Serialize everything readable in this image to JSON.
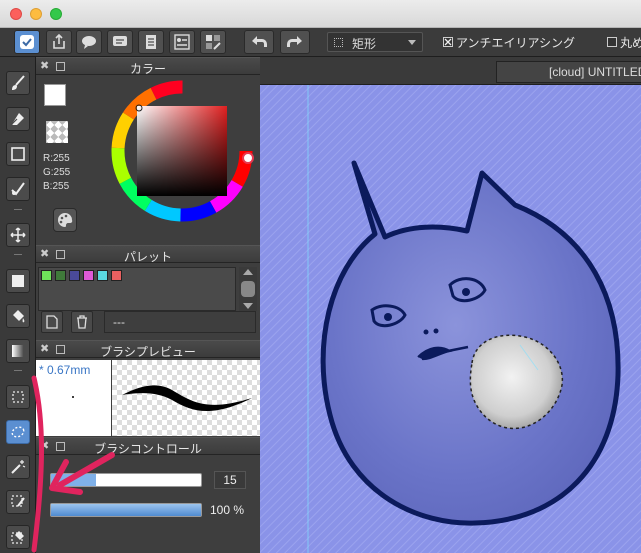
{
  "colors": {
    "canvas_bg": "#8a93e8",
    "cat_fill": "#6a74c8",
    "outline": "#0b1a5c",
    "annotation": "#e0245e",
    "accent": "#5b8fd1"
  },
  "toolbar": {
    "shape_select": "矩形",
    "antialias_label": "アンチエイリアシング",
    "antialias_checked": true,
    "round_label": "丸め",
    "round_checked": false,
    "icons": [
      "eye-icon",
      "share-icon",
      "comment-icon",
      "chat-icon",
      "document-icon",
      "panel-icon",
      "palette-icon",
      "undo-icon",
      "redo-icon"
    ]
  },
  "tools": [
    "brush-icon",
    "eraser-icon",
    "rectangle-icon",
    "smudge-icon",
    "move-icon",
    "fill-square-icon",
    "bucket-icon",
    "gradient-icon",
    "rect-select-icon",
    "lasso-select-icon",
    "magic-wand-icon",
    "select-pen-icon",
    "select-eraser-icon"
  ],
  "color_panel": {
    "title": "カラー",
    "r": "R:255",
    "g": "G:255",
    "b": "B:255",
    "primary_color": "#ffffff",
    "secondary_color": "#e8384f"
  },
  "palette_panel": {
    "title": "パレット",
    "swatches": [
      "#6fe35a",
      "#3f7a3a",
      "#4a4a9a",
      "#e05ad8",
      "#5ad8e0",
      "#e86060"
    ],
    "name": "---"
  },
  "brush_preview": {
    "title": "ブラシプレビュー",
    "size": "* 0.67mm"
  },
  "brush_control": {
    "title": "ブラシコントロール",
    "size_value": "15",
    "opacity_value": "100 %",
    "size_fraction": 0.3,
    "opacity_fraction": 1.0
  },
  "document": {
    "tab_label": "[cloud] UNTITLED"
  }
}
